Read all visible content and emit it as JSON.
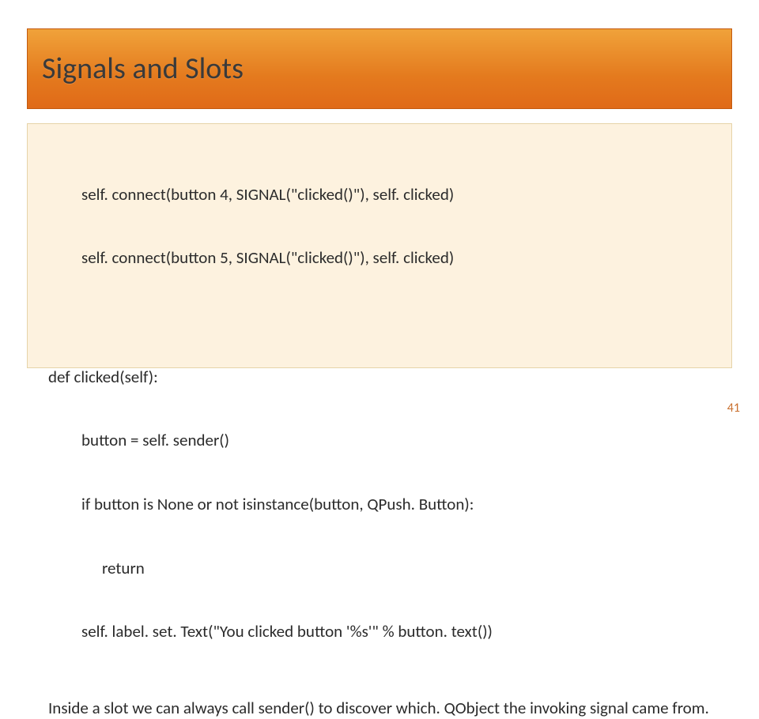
{
  "title": "Signals and Slots",
  "code": {
    "connect1": "self. connect(button 4, SIGNAL(\"clicked()\"), self. clicked)",
    "connect2": "self. connect(button 5, SIGNAL(\"clicked()\"), self. clicked)",
    "def_line": "def clicked(self):",
    "l1": "button = self. sender()",
    "l2": "if button is None or not isinstance(button, QPush. Button):",
    "l3": "return",
    "l4": "self. label. set. Text(\"You clicked button '%s'\" % button. text())"
  },
  "paragraph": "Inside a slot we can always call sender() to discover which. QObject the invoking signal came from.",
  "page_number": "41"
}
